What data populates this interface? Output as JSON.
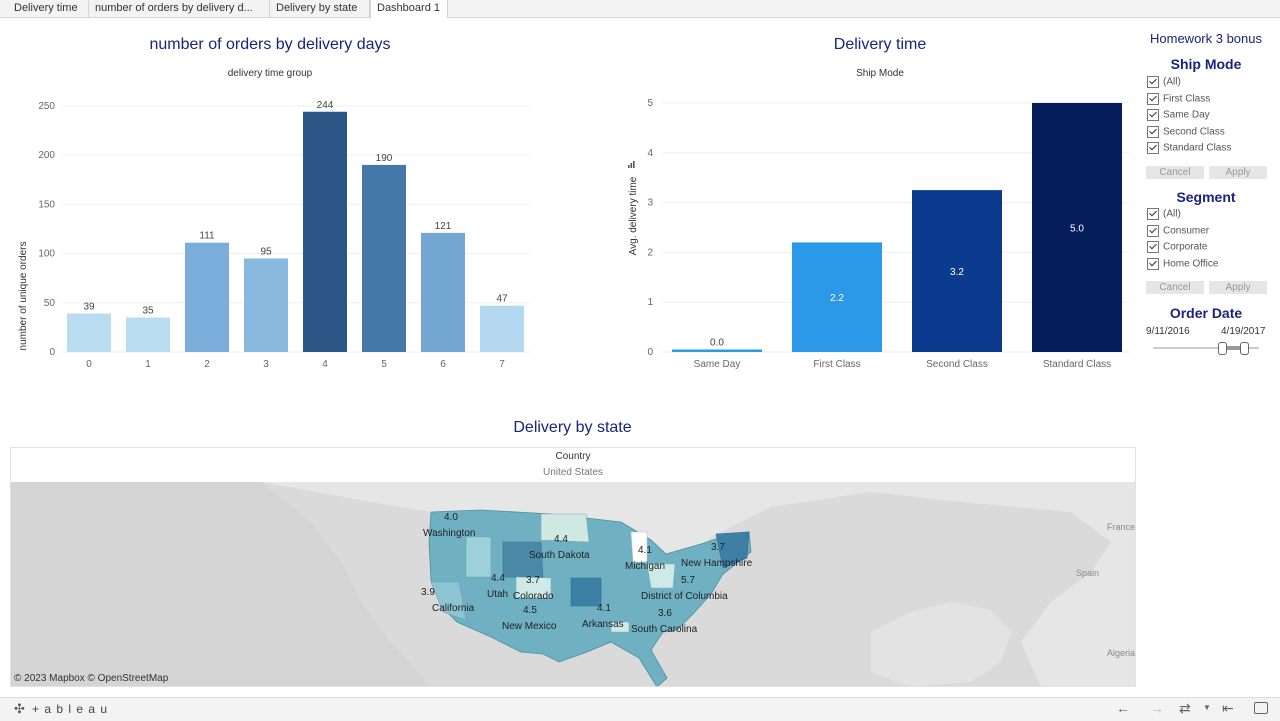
{
  "tabs": [
    {
      "label": "Delivery time"
    },
    {
      "label": "number of orders by delivery d..."
    },
    {
      "label": "Delivery by state"
    },
    {
      "label": "Dashboard 1"
    }
  ],
  "orders_chart": {
    "title": "number of orders by delivery days",
    "subtitle": "delivery time group",
    "ylabel": "number of unique orders",
    "yticks": [
      "0",
      "50",
      "100",
      "150",
      "200",
      "250"
    ]
  },
  "delivery_chart": {
    "title": "Delivery time",
    "subtitle": "Ship Mode",
    "ylabel": "Avg. delivery time",
    "yticks": [
      "0",
      "1",
      "2",
      "3",
      "4",
      "5"
    ]
  },
  "chart_data": [
    {
      "type": "bar",
      "title": "number of orders by delivery days",
      "xlabel": "delivery time group",
      "ylabel": "number of unique orders",
      "categories": [
        "0",
        "1",
        "2",
        "3",
        "4",
        "5",
        "6",
        "7"
      ],
      "values": [
        39,
        35,
        111,
        95,
        244,
        190,
        121,
        47
      ],
      "value_labels": [
        "39",
        "35",
        "111",
        "95",
        "244",
        "190",
        "121",
        "47"
      ],
      "ylim": [
        0,
        260
      ],
      "colors": [
        "#b9dcf1",
        "#b9dcf1",
        "#7aadd9",
        "#8ab9df",
        "#2b5686",
        "#4477aa",
        "#74a6d2",
        "#b4d8f0"
      ],
      "grid": true
    },
    {
      "type": "bar",
      "title": "Delivery time",
      "xlabel": "Ship Mode",
      "ylabel": "Avg. delivery time",
      "categories": [
        "Same Day",
        "First Class",
        "Second Class",
        "Standard Class"
      ],
      "values": [
        0.05,
        2.2,
        3.25,
        5.0
      ],
      "value_labels": [
        "0.0",
        "2.2",
        "3.2",
        "5.0"
      ],
      "ylim": [
        0,
        5.2
      ],
      "colors": [
        "#2c98e8",
        "#2c98e8",
        "#0b3a8e",
        "#061d5c"
      ],
      "grid": true
    }
  ],
  "sidebar": {
    "heading": "Homework 3 bonus",
    "ship_mode": {
      "title": "Ship Mode",
      "options": [
        "(All)",
        "First Class",
        "Same Day",
        "Second Class",
        "Standard Class"
      ],
      "cancel": "Cancel",
      "apply": "Apply"
    },
    "segment": {
      "title": "Segment",
      "options": [
        "(All)",
        "Consumer",
        "Corporate",
        "Home Office"
      ],
      "cancel": "Cancel",
      "apply": "Apply"
    },
    "order_date": {
      "title": "Order Date",
      "start": "9/11/2016",
      "end": "4/19/2017"
    }
  },
  "map": {
    "title": "Delivery by state",
    "country_label": "Country",
    "country_value": "United States",
    "attribution": "© 2023 Mapbox  © OpenStreetMap",
    "state_labels": [
      "Washington",
      "South Dakota",
      "Michigan",
      "New Hampshire",
      "California",
      "Utah",
      "Colorado",
      "District of Columbia",
      "New Mexico",
      "Arkansas",
      "South Carolina"
    ],
    "value_labels": [
      "4.0",
      "4.4",
      "4.1",
      "3.7",
      "5.7",
      "3.9",
      "4.4",
      "3.7",
      "4.5",
      "4.1",
      "3.6"
    ],
    "country_names": [
      "France",
      "Spain",
      "Algeria"
    ]
  },
  "footer": {
    "brand": "+ a b l e a u"
  }
}
